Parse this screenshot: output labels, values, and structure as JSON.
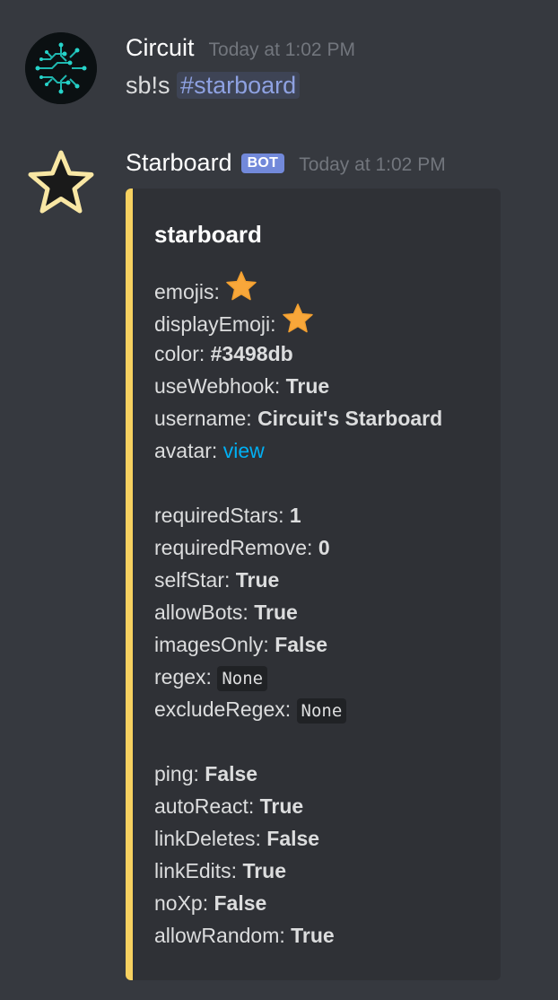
{
  "messages": [
    {
      "author": "Circuit",
      "timestamp": "Today at 1:02 PM",
      "content_prefix": "sb!s",
      "mention": "#starboard"
    },
    {
      "author": "Starboard",
      "bot_tag": "BOT",
      "timestamp": "Today at 1:02 PM",
      "embed": {
        "accent_color": "#f7d160",
        "title": "starboard",
        "fields": [
          {
            "key": "emojis:",
            "type": "emoji",
            "icon": "star-emoji"
          },
          {
            "key": "displayEmoji:",
            "type": "emoji",
            "icon": "star-emoji"
          },
          {
            "key": "color:",
            "value": "#3498db",
            "type": "bold"
          },
          {
            "key": "useWebhook:",
            "value": "True",
            "type": "bold"
          },
          {
            "key": "username:",
            "value": "Circuit's Starboard",
            "type": "bold"
          },
          {
            "key": "avatar:",
            "value": "view",
            "type": "link"
          },
          {
            "type": "blank"
          },
          {
            "key": "requiredStars:",
            "value": "1",
            "type": "bold"
          },
          {
            "key": "requiredRemove:",
            "value": "0",
            "type": "bold"
          },
          {
            "key": "selfStar:",
            "value": "True",
            "type": "bold"
          },
          {
            "key": "allowBots:",
            "value": "True",
            "type": "bold"
          },
          {
            "key": "imagesOnly:",
            "value": "False",
            "type": "bold"
          },
          {
            "key": "regex:",
            "value": "None",
            "type": "code"
          },
          {
            "key": "excludeRegex:",
            "value": "None",
            "type": "code"
          },
          {
            "type": "blank"
          },
          {
            "key": "ping:",
            "value": "False",
            "type": "bold"
          },
          {
            "key": "autoReact:",
            "value": "True",
            "type": "bold"
          },
          {
            "key": "linkDeletes:",
            "value": "False",
            "type": "bold"
          },
          {
            "key": "linkEdits:",
            "value": "True",
            "type": "bold"
          },
          {
            "key": "noXp:",
            "value": "False",
            "type": "bold"
          },
          {
            "key": "allowRandom:",
            "value": "True",
            "type": "bold"
          }
        ]
      }
    }
  ]
}
